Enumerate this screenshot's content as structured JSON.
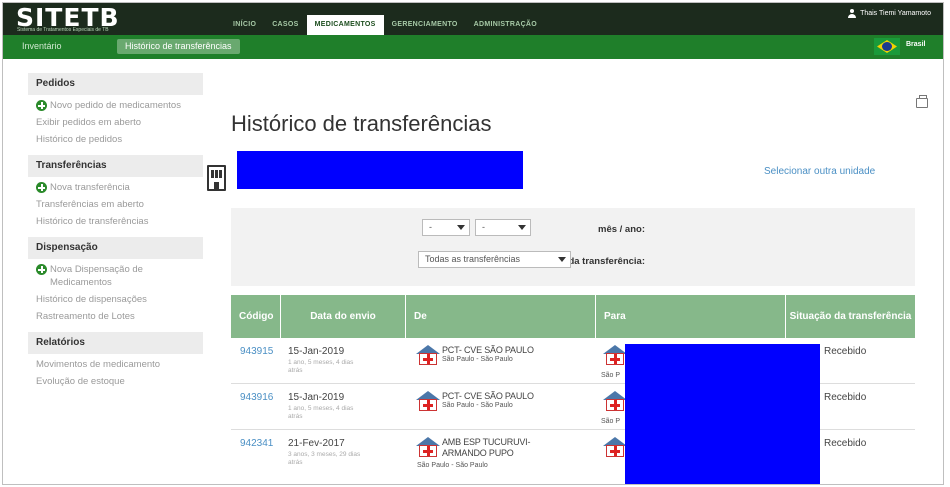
{
  "app": {
    "logo": "SITETB",
    "logo_subtitle": "Sistema de Tratamentos Especiais de TB"
  },
  "nav": {
    "tabs": [
      "INÍCIO",
      "CASOS",
      "MEDICAMENTOS",
      "GERENCIAMENTO",
      "ADMINISTRAÇÃO"
    ],
    "active": "MEDICAMENTOS"
  },
  "user": {
    "name": "Thais Tiemi Yamamoto"
  },
  "subnav": {
    "links": [
      "Inventário",
      "Histórico de transferências"
    ],
    "active": "Histórico de transferências",
    "language": "Brasil"
  },
  "sidebar": {
    "sections": [
      {
        "title": "Pedidos",
        "new_item": "Novo pedido de medicamentos",
        "items": [
          "Exibir pedidos em aberto",
          "Histórico de pedidos"
        ]
      },
      {
        "title": "Transferências",
        "new_item": "Nova transferência",
        "items": [
          "Transferências em aberto",
          "Histórico de transferências"
        ]
      },
      {
        "title": "Dispensação",
        "new_item": "Nova Dispensação de Medicamentos",
        "items": [
          "Histórico de dispensações",
          "Rastreamento de Lotes"
        ]
      },
      {
        "title": "Relatórios",
        "items": [
          "Movimentos de medicamento",
          "Evolução de estoque"
        ]
      }
    ]
  },
  "main": {
    "title": "Histórico de transferências",
    "select_unit_link": "Selecionar outra unidade"
  },
  "filter": {
    "month_year_label": "mês / ano:",
    "month_value": "-",
    "year_value": "-",
    "status_label": "Situação da transferência:",
    "status_value": "Todas as transferências"
  },
  "table": {
    "headers": [
      "Código",
      "Data do envio",
      "De",
      "Para",
      "Situação da transferência"
    ],
    "rows": [
      {
        "code": "943915",
        "date": "15-Jan-2019",
        "date_ago": "1 ano, 5 meses, 4 dias atrás",
        "from": "PCT- CVE SÃO PAULO",
        "from_city": "São Paulo - São Paulo",
        "to_city": "São P",
        "status": "Recebido"
      },
      {
        "code": "943916",
        "date": "15-Jan-2019",
        "date_ago": "1 ano, 5 meses, 4 dias atrás",
        "from": "PCT- CVE SÃO PAULO",
        "from_city": "São Paulo - São Paulo",
        "to_city": "São P",
        "status": "Recebido"
      },
      {
        "code": "942341",
        "date": "21-Fev-2017",
        "date_ago": "3 anos, 3 meses, 29 dias atrás",
        "from": "AMB ESP TUCURUVI-",
        "from2": "ARMANDO PUPO",
        "from_city": "São Paulo - São Paulo",
        "status": "Recebido"
      }
    ]
  },
  "colors": {
    "top_bar": "#1c2b1d",
    "sub_bar": "#1f7f2a",
    "table_header": "#86b88a",
    "link": "#4a8fc4",
    "redaction": "#0000ff"
  }
}
